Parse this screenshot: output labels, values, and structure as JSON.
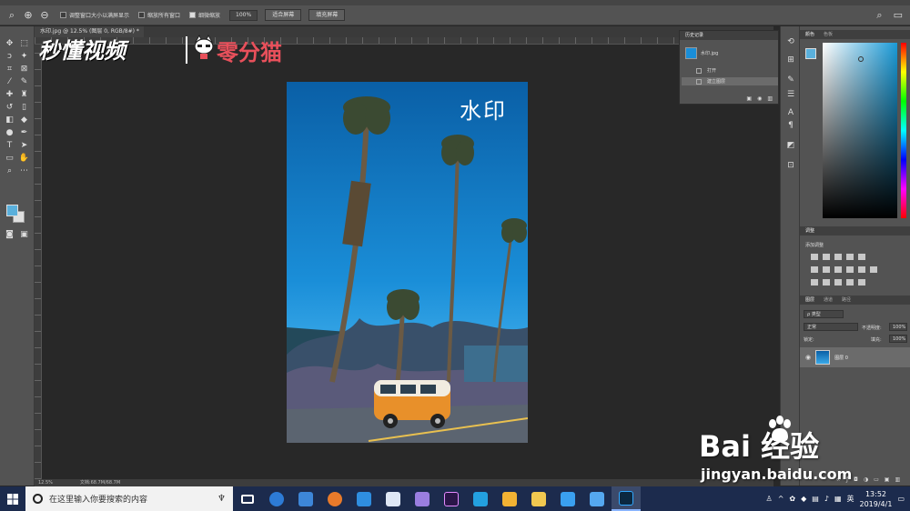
{
  "window": {
    "doc_tab": "水印.jpg @ 12.5% (图层 0, RGB/8#) *"
  },
  "options_bar": {
    "resize_windows": "调整窗口大小以满屏显示",
    "zoom_all_windows": "缩放所有窗口",
    "scrubby_zoom": "细微缩放",
    "zoom_value": "100%",
    "fit_screen": "适合屏幕",
    "fill_screen": "填充屏幕"
  },
  "canvas": {
    "watermark_text": "水印"
  },
  "statusbar": {
    "zoom": "12.5%",
    "doc_size": "文档:68.7M/68.7M"
  },
  "history_panel": {
    "title": "历史记录",
    "snapshot": "水印.jpg",
    "items": [
      "打开",
      "建立图层"
    ]
  },
  "color_panel": {
    "tabs": [
      "颜色",
      "色板"
    ],
    "foreground": "#5ab0dc",
    "background": "#e0e0e0"
  },
  "adjustments_panel": {
    "title": "调整",
    "add_label": "添加调整"
  },
  "layers_panel": {
    "tabs": [
      "图层",
      "通道",
      "路径"
    ],
    "filter": "类型",
    "blend_mode": "正常",
    "opacity_label": "不透明度:",
    "opacity": "100%",
    "lock_label": "锁定:",
    "fill_label": "填充:",
    "fill": "100%",
    "layer_name": "图层 0"
  },
  "watermarks": {
    "logo1": "秒懂视频",
    "logo2": "零分猫",
    "baidu": "Bai 经验",
    "baidu_url": "jingyan.baidu.com"
  },
  "taskbar": {
    "search_placeholder": "在这里输入你要搜索的内容",
    "ime": "英",
    "time": "13:52",
    "date": "2019/4/1"
  }
}
